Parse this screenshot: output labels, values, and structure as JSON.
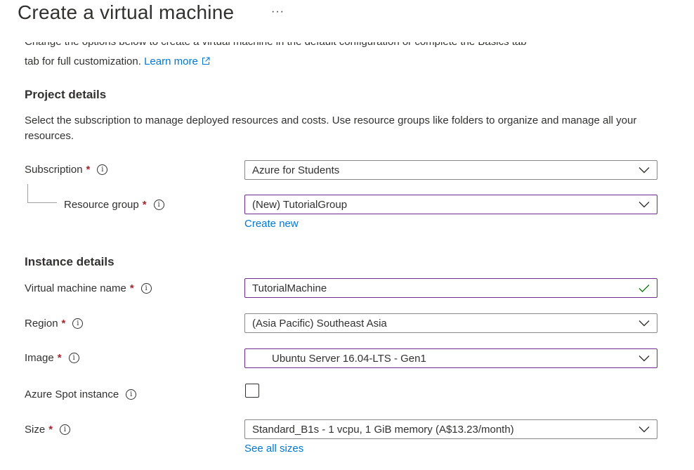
{
  "header": {
    "title": "Create a virtual machine",
    "more": "···"
  },
  "intro": {
    "clipped_text": "Change the options below to create a virtual machine in the default configuration or complete the Basics tab",
    "text": "tab for full customization.",
    "learn_more": "Learn more"
  },
  "project": {
    "heading": "Project details",
    "description": "Select the subscription to manage deployed resources and costs. Use resource groups like folders to organize and manage all your resources.",
    "subscription": {
      "label": "Subscription",
      "value": "Azure for Students"
    },
    "resource_group": {
      "label": "Resource group",
      "value": "(New) TutorialGroup",
      "create_new": "Create new"
    }
  },
  "instance": {
    "heading": "Instance details",
    "vm_name": {
      "label": "Virtual machine name",
      "value": "TutorialMachine"
    },
    "region": {
      "label": "Region",
      "value": "(Asia Pacific) Southeast Asia"
    },
    "image": {
      "label": "Image",
      "value": "Ubuntu Server 16.04-LTS - Gen1"
    },
    "spot": {
      "label": "Azure Spot instance",
      "checked": false
    },
    "size": {
      "label": "Size",
      "value": "Standard_B1s - 1 vcpu, 1 GiB memory (A$13.23/month)",
      "see_all": "See all sizes"
    }
  },
  "common": {
    "required_mark": "*",
    "info_glyph": "i"
  },
  "colors": {
    "accent": "#0078d4",
    "required": "#a4262c",
    "focus_border": "#6b2e8f",
    "valid": "#107c10"
  }
}
